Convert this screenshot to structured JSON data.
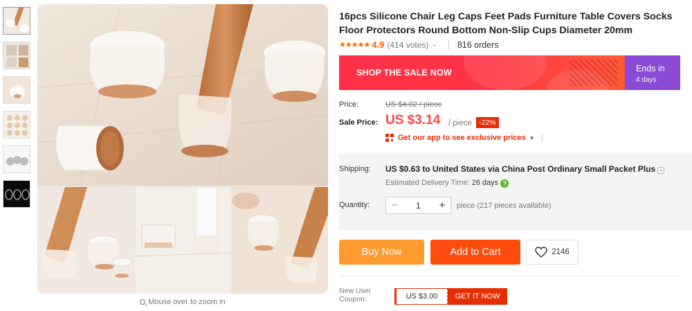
{
  "product": {
    "title": "16pcs Silicone Chair Leg Caps Feet Pads Furniture Table Covers Socks Floor Protectors Round Bottom Non-Slip Cups Diameter 20mm",
    "stars": "★★★★★",
    "rating": "4.9",
    "votes": "(414 votes)",
    "orders": "816 orders"
  },
  "banner": {
    "label": "SHOP THE SALE NOW",
    "ends_label": "Ends in",
    "ends_value": "4 days",
    "colors": {
      "main": "#ff3446",
      "end": "#8b4ad6"
    }
  },
  "price": {
    "price_label": "Price:",
    "original": "US $4.02 / piece",
    "sale_label": "Sale Price:",
    "sale": "US $3.14",
    "unit": "/ piece",
    "discount": "-22%",
    "app_promo": "Get our app to see exclusive prices",
    "accent_color": "#ff4747"
  },
  "shipping": {
    "label": "Shipping:",
    "text": "US $0.63 to United States via China Post Ordinary Small Packet Plus",
    "delivery_label": "Estimated Delivery Time:",
    "delivery_value": "26 days"
  },
  "quantity": {
    "label": "Quantity:",
    "minus": "−",
    "value": "1",
    "plus": "+",
    "available": "piece (217 pieces available)"
  },
  "actions": {
    "buy_now": "Buy Now",
    "add_to_cart": "Add to Cart",
    "wishlist_count": "2146",
    "colors": {
      "buy": "#ff9a2e",
      "cart": "#ff4c0d"
    }
  },
  "coupon": {
    "label": "New User Coupon:",
    "value": "US $3.00",
    "action": "GET IT NOW"
  },
  "gallery": {
    "zoom_hint": "Mouse over to zoom in",
    "thumbnail_count": 6
  }
}
